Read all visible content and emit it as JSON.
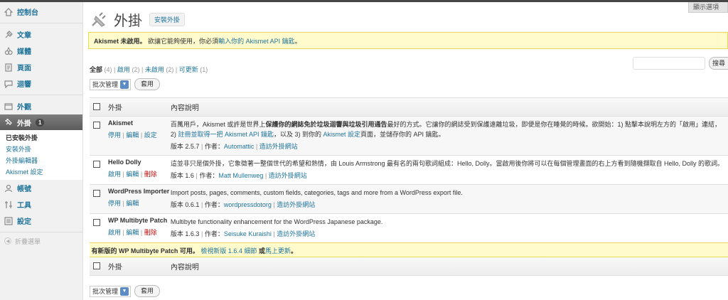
{
  "sidebar": {
    "items": [
      {
        "label": "控制台",
        "icon": "dashboard-icon"
      },
      {
        "label": "文章",
        "icon": "pushpin-icon"
      },
      {
        "label": "媒體",
        "icon": "media-icon"
      },
      {
        "label": "頁面",
        "icon": "page-icon"
      },
      {
        "label": "迴響",
        "icon": "comment-icon"
      },
      {
        "label": "外觀",
        "icon": "appearance-icon"
      },
      {
        "label": "外掛",
        "icon": "plugin-icon",
        "badge": "1"
      },
      {
        "label": "帳號",
        "icon": "users-icon"
      },
      {
        "label": "工具",
        "icon": "tools-icon"
      },
      {
        "label": "設定",
        "icon": "settings-icon"
      }
    ],
    "submenu": [
      "已安裝外掛",
      "安裝外掛",
      "外掛編輯器",
      "Akismet 設定"
    ],
    "collapse": "折疊選單"
  },
  "screen_options": "顯示選項",
  "header": {
    "title": "外掛",
    "add_new": "安裝外掛"
  },
  "notice": {
    "bold": "Akismet 未啟用。",
    "text": "欲讓它能夠使用，你必須 ",
    "link": "輸入你的 Akismet API 鑰匙",
    "end": "。"
  },
  "filters": {
    "all": "全部",
    "all_count": "(4)",
    "active": "啟用",
    "active_count": "(2)",
    "inactive": "未啟用",
    "inactive_count": "(2)",
    "upgrade": "可更新",
    "upgrade_count": "(1)",
    "sep": "|"
  },
  "search": {
    "button": "搜尋"
  },
  "bulk": {
    "select": "批次管理",
    "apply": "套用"
  },
  "table": {
    "col_name": "外掛",
    "col_desc": "內容說明"
  },
  "plugins": [
    {
      "name": "Akismet",
      "actions": [
        "停用",
        "編輯",
        "設定"
      ],
      "desc1": "百萬用戶，Akismet 或許是世界上",
      "desc_bold": "保護你的網誌免於垃圾迴響與垃圾引用通告",
      "desc2": "最好的方式。它讓你的網誌受到保護遠離垃圾，即便是你在睡覺的時候。欲開始：1) 點擊本說明左方的「啟用」連結，2) ",
      "desc_link1": "註冊並取得一把 Akismet API 鑰匙",
      "desc3": "，以及 3) 到你的 ",
      "desc_link2": "Akismet 設定",
      "desc4": "頁面，並儲存你的 API 鑰匙。",
      "version": "版本 2.5.7",
      "by": "作者：",
      "author": "Automattic",
      "site": "造訪外掛網站"
    },
    {
      "name": "Hello Dolly",
      "actions": [
        "啟用",
        "編輯",
        "刪除"
      ],
      "desc1": "這並非只是個外掛，它象徵著一整個世代的希望和熱情，由 Louis Armstrong 最有名的兩句歌詞組成：Hello, Dolly。當啟用後你將可以在每個管理畫面的右上方看到隨機擷取自 Hello, Dolly 的歌詞。",
      "version": "版本 1.6",
      "by": "作者：",
      "author": "Matt Mullenweg",
      "site": "造訪外掛網站"
    },
    {
      "name": "WordPress Importer",
      "actions": [
        "停用",
        "編輯"
      ],
      "desc1": "Import posts, pages, comments, custom fields, categories, tags and more from a WordPress export file.",
      "version": "版本 0.6.1",
      "by": "作者：",
      "author": "wordpressdotorg",
      "site": "造訪外掛網站"
    },
    {
      "name": "WP Multibyte Patch",
      "actions": [
        "啟用",
        "編輯",
        "刪除"
      ],
      "desc1": "Multibyte functionality enhancement for the WordPress Japanese package.",
      "version": "版本 1.6.3",
      "by": "作者：",
      "author": "Seisuke Kuraishi",
      "site": "造訪外掛網站"
    }
  ],
  "update": {
    "text1": "有新版的 WP Multibyte Patch 可用。",
    "link1": "檢視新版 1.6.4 細節",
    "or": " 或",
    "link2": "馬上更新",
    "end": "。"
  }
}
